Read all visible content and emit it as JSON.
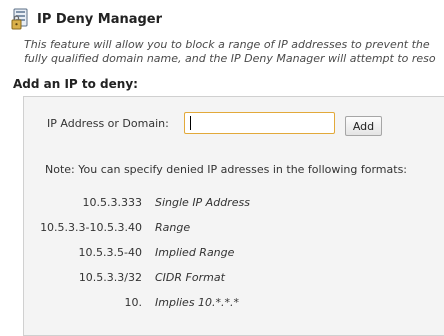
{
  "header": {
    "icon": "network-security-icon",
    "title": "IP Deny Manager"
  },
  "description": {
    "line1": "This feature will allow you to block a range of IP addresses to prevent the",
    "line2": "fully qualified domain name, and the IP Deny Manager will attempt to reso"
  },
  "form": {
    "heading": "Add an IP to deny:",
    "input_label": "IP Address or Domain:",
    "input_value": "",
    "add_label": "Add",
    "note": "Note: You can specify denied IP adresses in the following formats:"
  },
  "formats": [
    {
      "example": "10.5.3.333",
      "description": "Single IP Address"
    },
    {
      "example": "10.5.3.3-10.5.3.40",
      "description": "Range"
    },
    {
      "example": "10.5.3.5-40",
      "description": "Implied Range"
    },
    {
      "example": "10.5.3.3/32",
      "description": "CIDR Format"
    },
    {
      "example": "10.",
      "description": "Implies 10.*.*.*"
    }
  ],
  "colors": {
    "input_focus_border": "#e2a93a",
    "panel_background": "#f4f4f4"
  }
}
